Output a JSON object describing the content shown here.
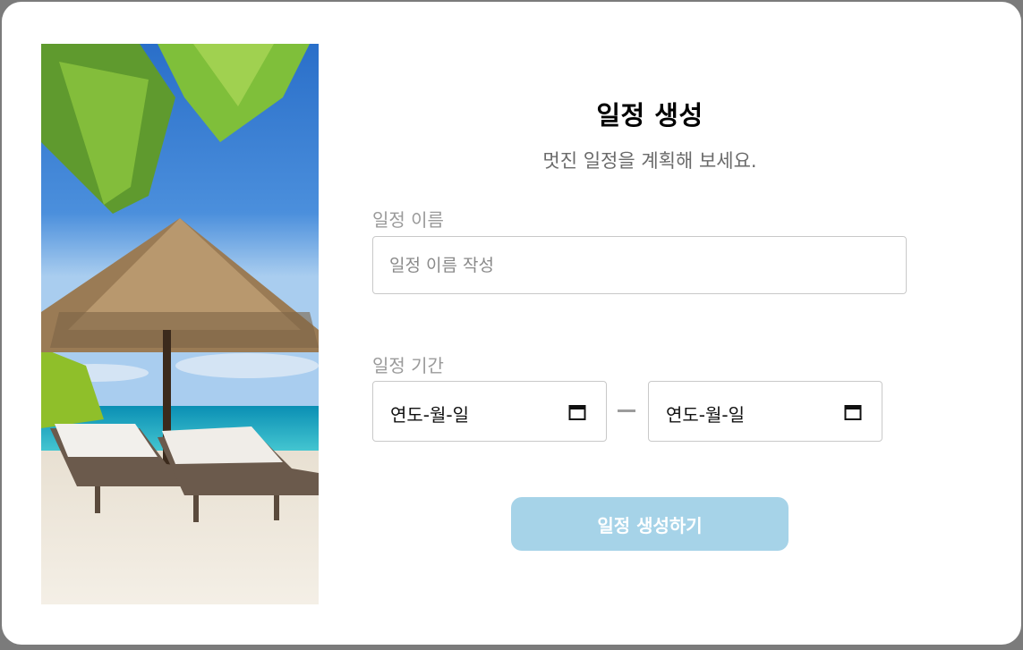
{
  "modal": {
    "title": "일정 생성",
    "subtitle": "멋진 일정을 계획해 보세요."
  },
  "hero_image": {
    "icon": "beach-image"
  },
  "name_field": {
    "label": "일정 이름",
    "placeholder": "일정 이름 작성",
    "value": ""
  },
  "period_field": {
    "label": "일정 기간",
    "start_placeholder": "연도-월-일",
    "end_placeholder": "연도-월-일",
    "icon": "calendar-icon"
  },
  "submit": {
    "label": "일정 생성하기",
    "color": "#a6d3e8"
  }
}
